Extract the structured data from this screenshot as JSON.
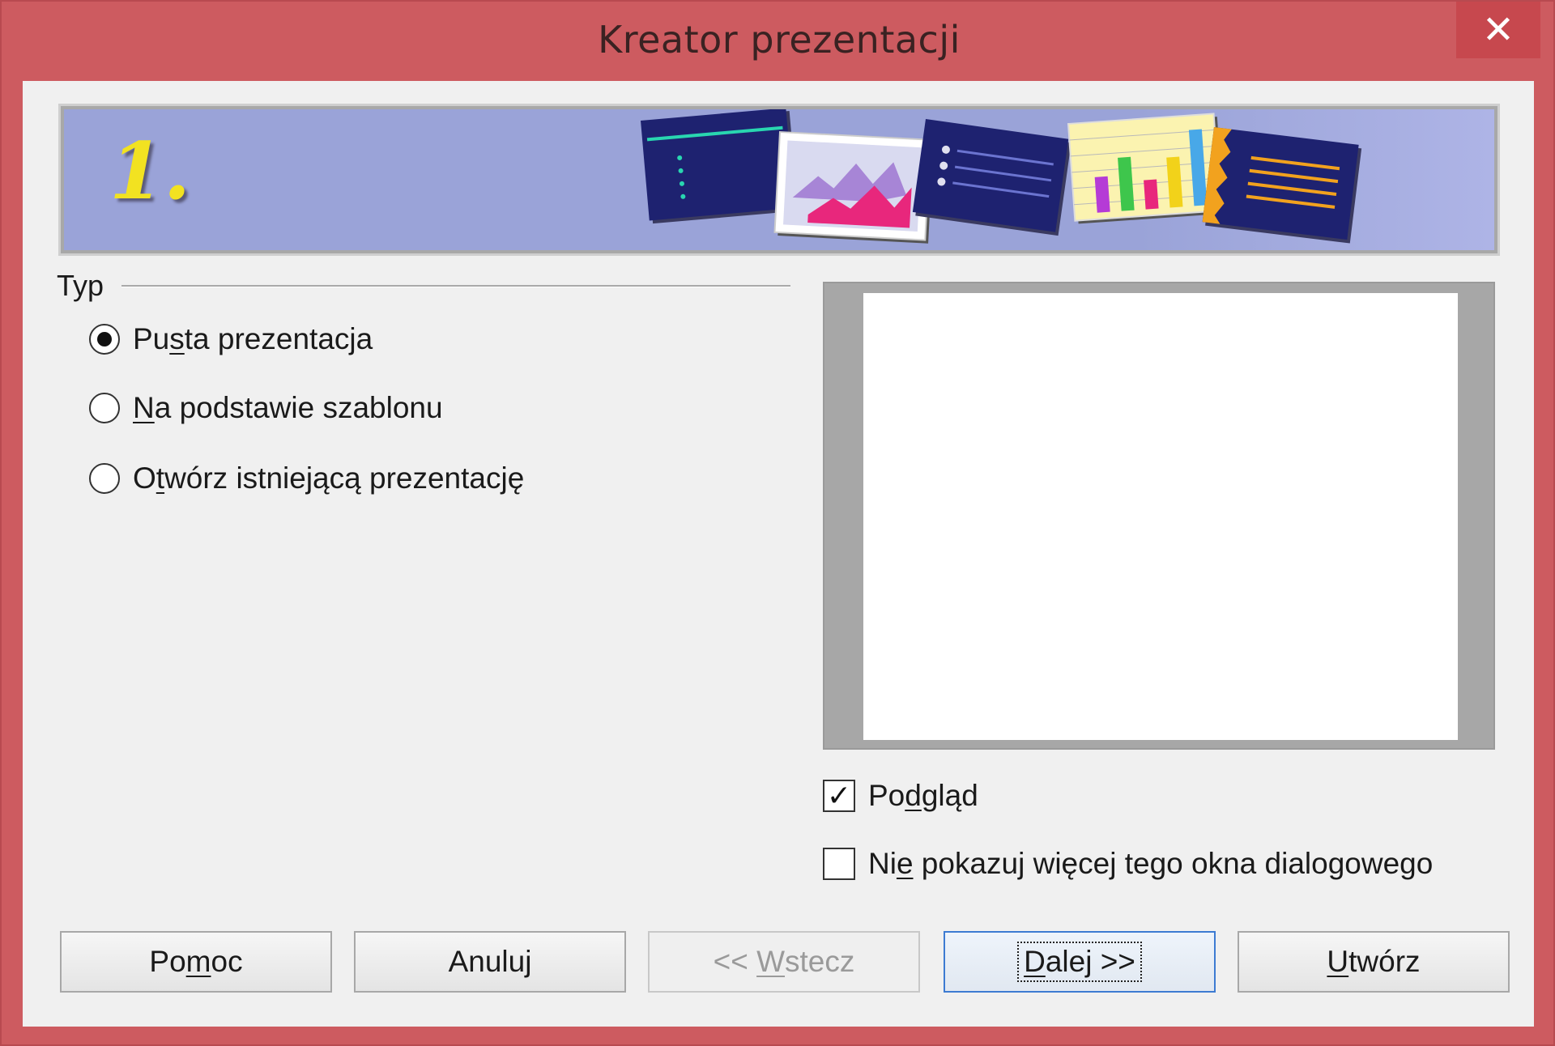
{
  "window": {
    "title": "Kreator prezentacji",
    "close_icon": "close-icon"
  },
  "banner": {
    "step": "1."
  },
  "type_group": {
    "label": "Typ",
    "options": [
      {
        "pre": "Pu",
        "mn": "s",
        "post": "ta prezentacja",
        "checked": true
      },
      {
        "pre": "",
        "mn": "N",
        "post": "a podstawie szablonu",
        "checked": false
      },
      {
        "pre": "O",
        "mn": "t",
        "post": "wórz istniejącą prezentację",
        "checked": false
      }
    ]
  },
  "preview_checkbox": {
    "pre": "Po",
    "mn": "d",
    "post": "gląd",
    "checked": true
  },
  "dont_show_checkbox": {
    "pre": "Ni",
    "mn": "e",
    "post": " pokazuj więcej tego okna dialogowego",
    "checked": false
  },
  "buttons": {
    "help": {
      "pre": "Po",
      "mn": "m",
      "post": "oc"
    },
    "cancel": {
      "pre": "Anuluj",
      "mn": "",
      "post": ""
    },
    "back": {
      "pre": "<< ",
      "mn": "W",
      "post": "stecz"
    },
    "next": {
      "pre": "",
      "mn": "D",
      "post": "alej >>"
    },
    "create": {
      "pre": "",
      "mn": "U",
      "post": "twórz"
    }
  },
  "colors": {
    "titlebar": "#cd5b60",
    "close_button": "#c7484e",
    "banner_bg": "#9aa3d8",
    "step_number": "#f2e221",
    "default_button_border": "#3d7bd2"
  }
}
